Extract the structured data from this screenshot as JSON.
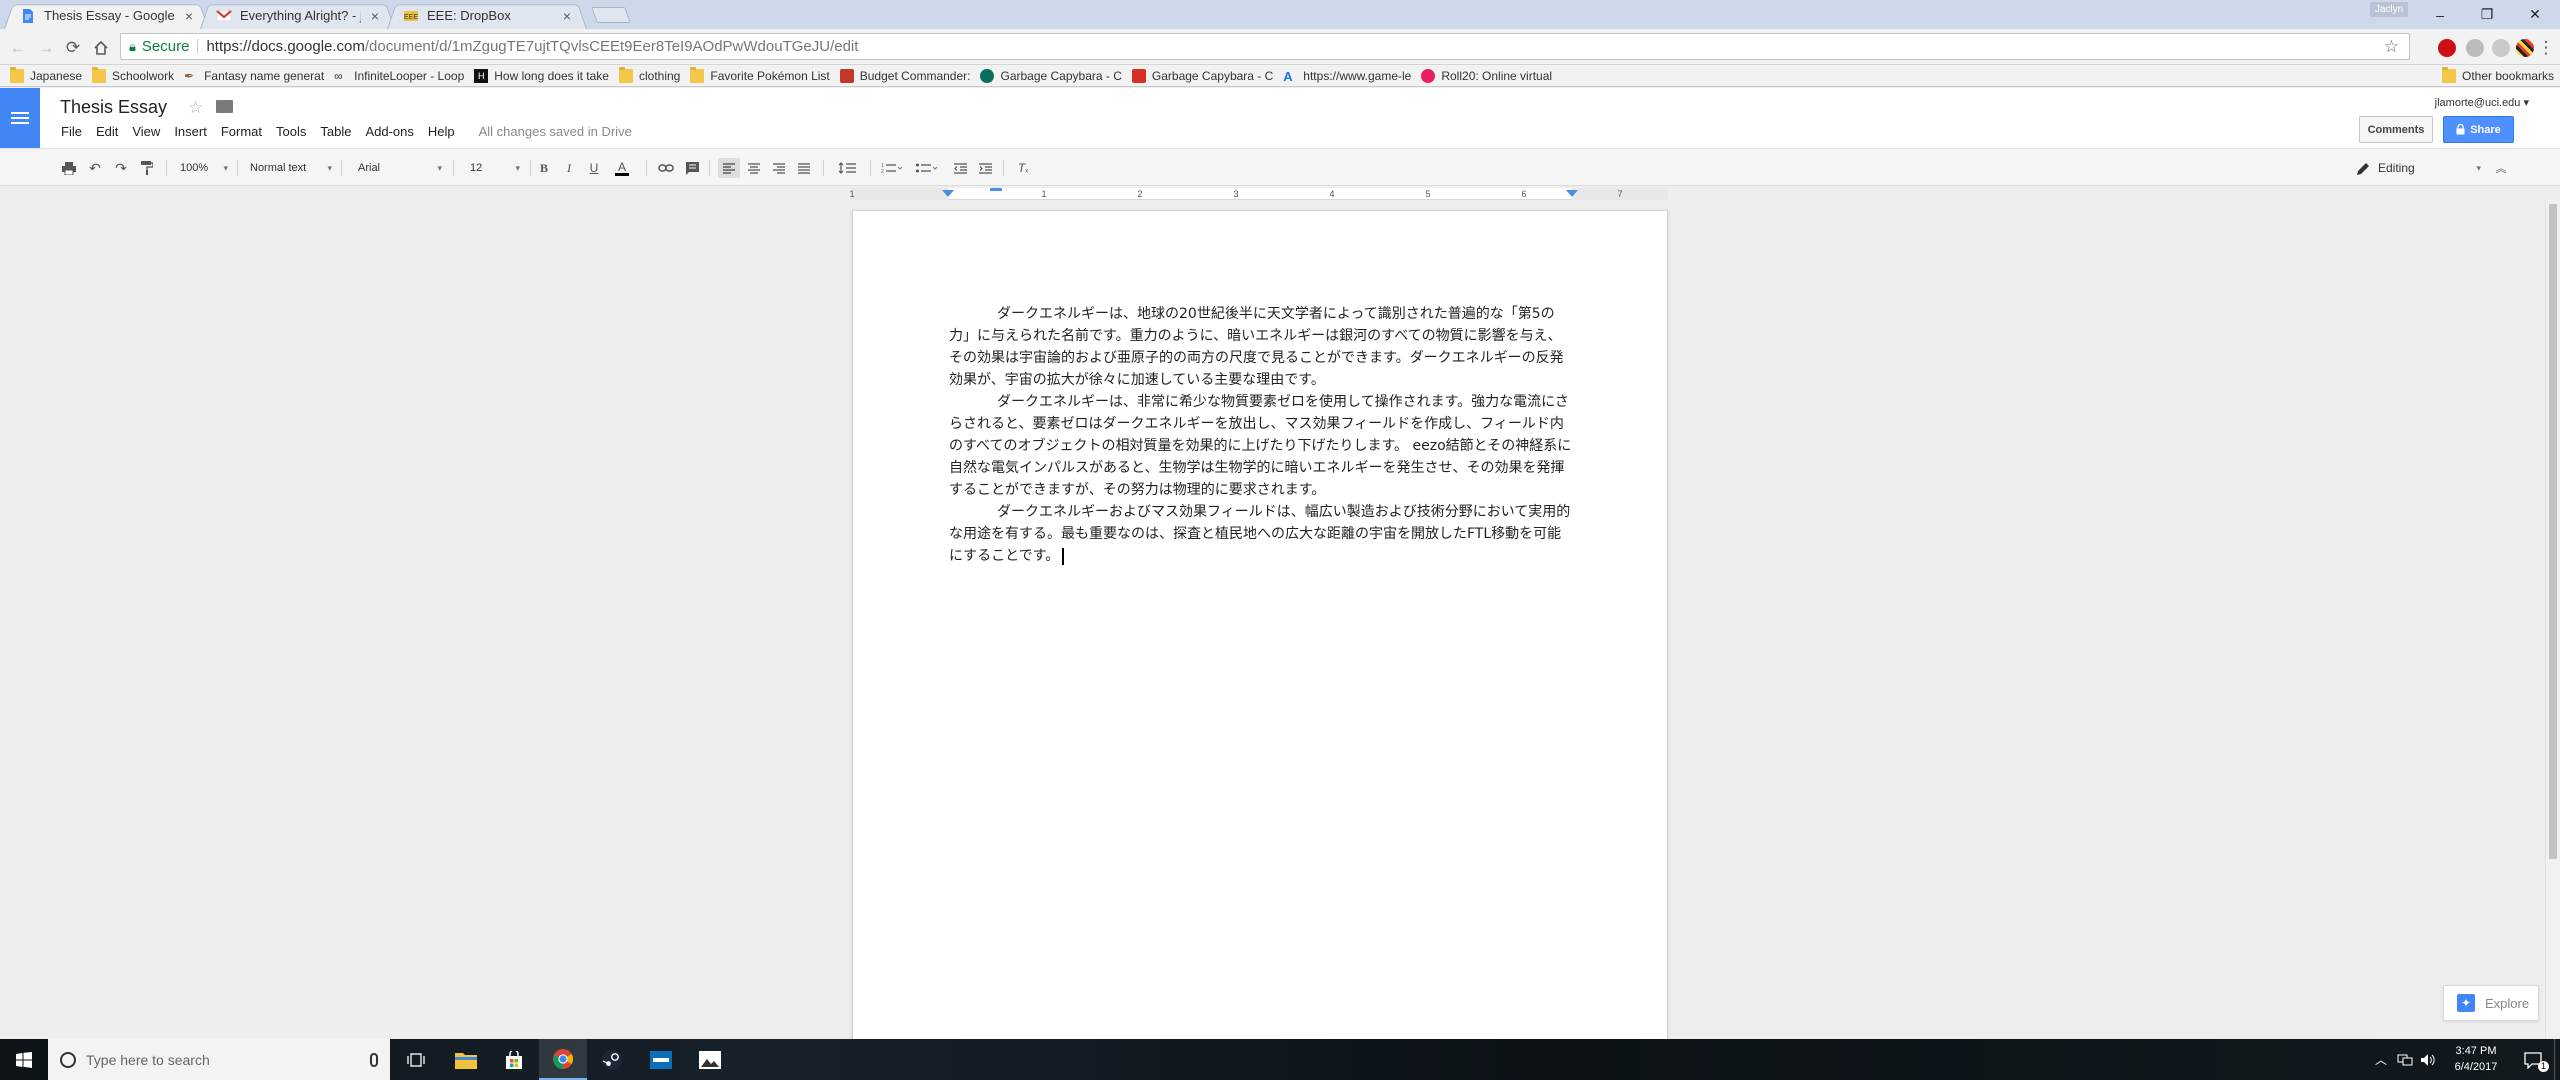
{
  "browser": {
    "tabs": [
      {
        "title": "Thesis Essay - Google Do",
        "icon": "google-docs-icon",
        "active": true
      },
      {
        "title": "Everything Alright? - jlam",
        "icon": "gmail-icon",
        "active": false
      },
      {
        "title": "EEE: DropBox",
        "icon": "eee-icon",
        "active": false
      }
    ],
    "close_glyph": "×",
    "profile_label": "Jaclyn",
    "window_controls": {
      "minimize": "–",
      "restore": "❐",
      "close": "✕"
    },
    "omnibox": {
      "secure_label": "Secure",
      "url_host": "https://docs.google.com",
      "url_path": "/document/d/1mZgugTE7ujtTQvlsCEEt9Eer8TeI9AOdPwWdouTGeJU/edit"
    },
    "bookmarks": [
      {
        "label": "Japanese",
        "icon": "folder-icon"
      },
      {
        "label": "Schoolwork",
        "icon": "folder-icon"
      },
      {
        "label": "Fantasy name generat",
        "icon": "fantasy-icon"
      },
      {
        "label": "InfiniteLooper - Loop",
        "icon": "infinite-loop-icon"
      },
      {
        "label": "How long does it take",
        "icon": "howlong-icon"
      },
      {
        "label": "clothing",
        "icon": "folder-icon"
      },
      {
        "label": "Favorite Pokémon List",
        "icon": "folder-icon"
      },
      {
        "label": "Budget Commander:",
        "icon": "budget-icon"
      },
      {
        "label": "Garbage Capybara - C",
        "icon": "capybara-icon"
      },
      {
        "label": "Garbage Capybara - C",
        "icon": "capybara-red-icon"
      },
      {
        "label": "https://www.game-le",
        "icon": "game-icon"
      },
      {
        "label": "Roll20: Online virtual",
        "icon": "roll20-icon"
      }
    ],
    "other_bookmarks": "Other bookmarks"
  },
  "docs": {
    "title": "Thesis Essay",
    "account": "jlamorte@uci.edu",
    "menu": [
      "File",
      "Edit",
      "View",
      "Insert",
      "Format",
      "Tools",
      "Table",
      "Add-ons",
      "Help"
    ],
    "save_status": "All changes saved in Drive",
    "comments_label": "Comments",
    "share_label": "Share",
    "toolbar": {
      "zoom": "100%",
      "style": "Normal text",
      "font": "Arial",
      "size": "12",
      "mode": "Editing"
    },
    "ruler_numbers": [
      "1",
      "1",
      "2",
      "3",
      "4",
      "5",
      "6",
      "7"
    ],
    "paragraphs": [
      "ダークエネルギーは、地球の20世紀後半に天文学者によって識別された普遍的な「第5の力」に与えられた名前です。重力のように、暗いエネルギーは銀河のすべての物質に影響を与え、その効果は宇宙論的および亜原子的の両方の尺度で見ることができます。ダークエネルギーの反発効果が、宇宙の拡大が徐々に加速している主要な理由です。",
      "ダークエネルギーは、非常に希少な物質要素ゼロを使用して操作されます。強力な電流にさらされると、要素ゼロはダークエネルギーを放出し、マス効果フィールドを作成し、フィールド内のすべてのオブジェクトの相対質量を効果的に上げたり下げたりします。 eezo結節とその神経系に自然な電気インパルスがあると、生物学は生物学的に暗いエネルギーを発生させ、その効果を発揮することができますが、その努力は物理的に要求されます。",
      "ダークエネルギーおよびマス効果フィールドは、幅広い製造および技術分野において実用的な用途を有する。最も重要なのは、探査と植民地への広大な距離の宇宙を開放したFTL移動を可能にすることです。"
    ],
    "explore_label": "Explore"
  },
  "taskbar": {
    "search_placeholder": "Type here to search",
    "time": "3:47 PM",
    "date": "6/4/2017",
    "notification_count": "1"
  }
}
